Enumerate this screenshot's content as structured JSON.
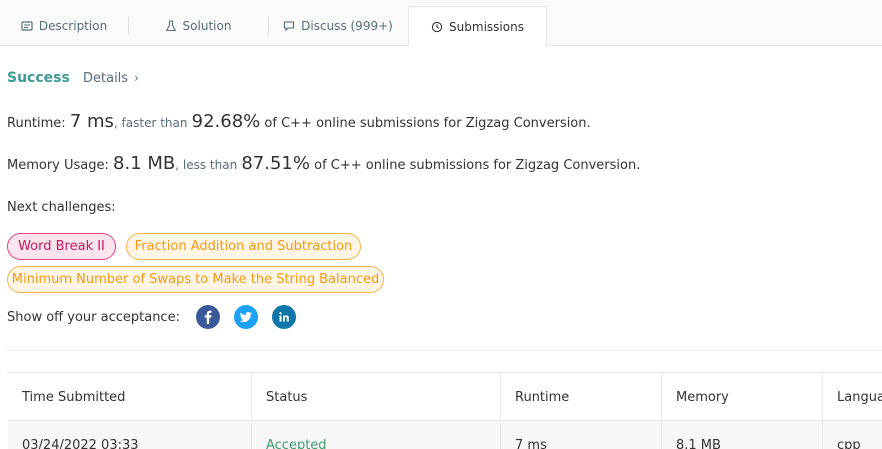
{
  "tabs": {
    "description": "Description",
    "solution": "Solution",
    "discuss": "Discuss (999+)",
    "submissions": "Submissions"
  },
  "result": {
    "status": "Success",
    "details": "Details"
  },
  "runtime": {
    "label": "Runtime:",
    "value": "7 ms",
    "comparison": ", faster than",
    "percent": "92.68%",
    "suffix": "of C++ online submissions for Zigzag Conversion."
  },
  "memory": {
    "label": "Memory Usage:",
    "value": "8.1 MB",
    "comparison": ", less than",
    "percent": "87.51%",
    "suffix": "of C++ online submissions for Zigzag Conversion."
  },
  "next_challenges": {
    "label": "Next challenges:",
    "items": [
      {
        "title": "Word Break II",
        "difficulty": "hard",
        "color": "#c2185b"
      },
      {
        "title": "Fraction Addition and Subtraction",
        "difficulty": "medium",
        "color": "#ef9a1c"
      },
      {
        "title": "Minimum Number of Swaps to Make the String Balanced",
        "difficulty": "medium",
        "color": "#ef9a1c"
      }
    ]
  },
  "share": {
    "label": "Show off your acceptance:",
    "icons": [
      "facebook-icon",
      "twitter-icon",
      "linkedin-icon"
    ]
  },
  "table": {
    "headers": [
      "Time Submitted",
      "Status",
      "Runtime",
      "Memory",
      "Langua"
    ],
    "rows": [
      [
        "03/24/2022 03:33",
        "Accepted",
        "7 ms",
        "8.1 MB",
        "cpp"
      ]
    ]
  },
  "colors": {
    "success": "#3d9b95",
    "accepted": "#3d9b6e",
    "hard": "#c2185b",
    "medium": "#ef9a1c"
  }
}
